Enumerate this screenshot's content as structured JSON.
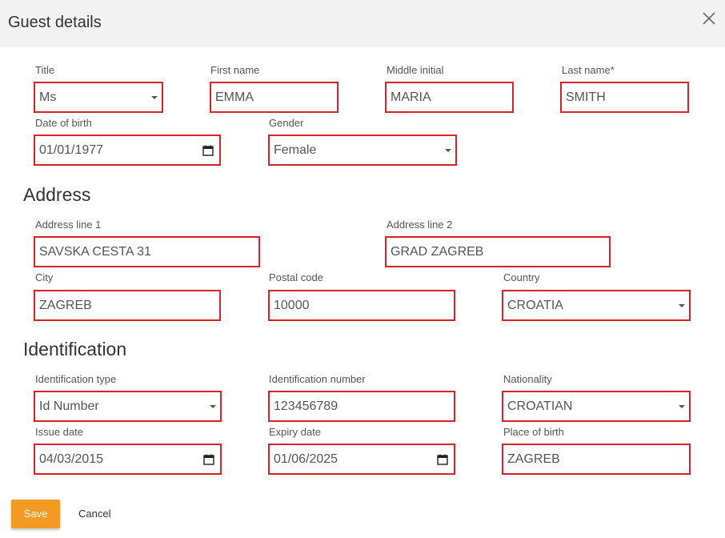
{
  "dialog": {
    "title": "Guest details",
    "close_icon": "close-icon"
  },
  "personal": {
    "title": {
      "label": "Title",
      "value": "Ms"
    },
    "first_name": {
      "label": "First name",
      "value": "EMMA"
    },
    "middle_initial": {
      "label": "Middle initial",
      "value": "MARIA"
    },
    "last_name": {
      "label": "Last name*",
      "value": "SMITH"
    },
    "date_of_birth": {
      "label": "Date of birth",
      "value": "01/01/1977"
    },
    "gender": {
      "label": "Gender",
      "value": "Female"
    }
  },
  "address": {
    "section_title": "Address",
    "line1": {
      "label": "Address line 1",
      "value": "SAVSKA CESTA 31"
    },
    "line2": {
      "label": "Address line 2",
      "value": "GRAD ZAGREB"
    },
    "city": {
      "label": "City",
      "value": "ZAGREB"
    },
    "postal_code": {
      "label": "Postal code",
      "value": "10000"
    },
    "country": {
      "label": "Country",
      "value": "CROATIA"
    }
  },
  "identification": {
    "section_title": "Identification",
    "type": {
      "label": "Identification type",
      "value": "Id Number"
    },
    "number": {
      "label": "Identification number",
      "value": "123456789"
    },
    "nationality": {
      "label": "Nationality",
      "value": "CROATIAN"
    },
    "issue_date": {
      "label": "Issue date",
      "value": "04/03/2015"
    },
    "expiry_date": {
      "label": "Expiry date",
      "value": "01/06/2025"
    },
    "place_of_birth": {
      "label": "Place of birth",
      "value": "ZAGREB"
    }
  },
  "actions": {
    "save_label": "Save",
    "cancel_label": "Cancel"
  },
  "colors": {
    "header_bg": "#f2f2f2",
    "field_border": "#d9222a",
    "save_bg": "#f39a22",
    "text": "#555555"
  }
}
